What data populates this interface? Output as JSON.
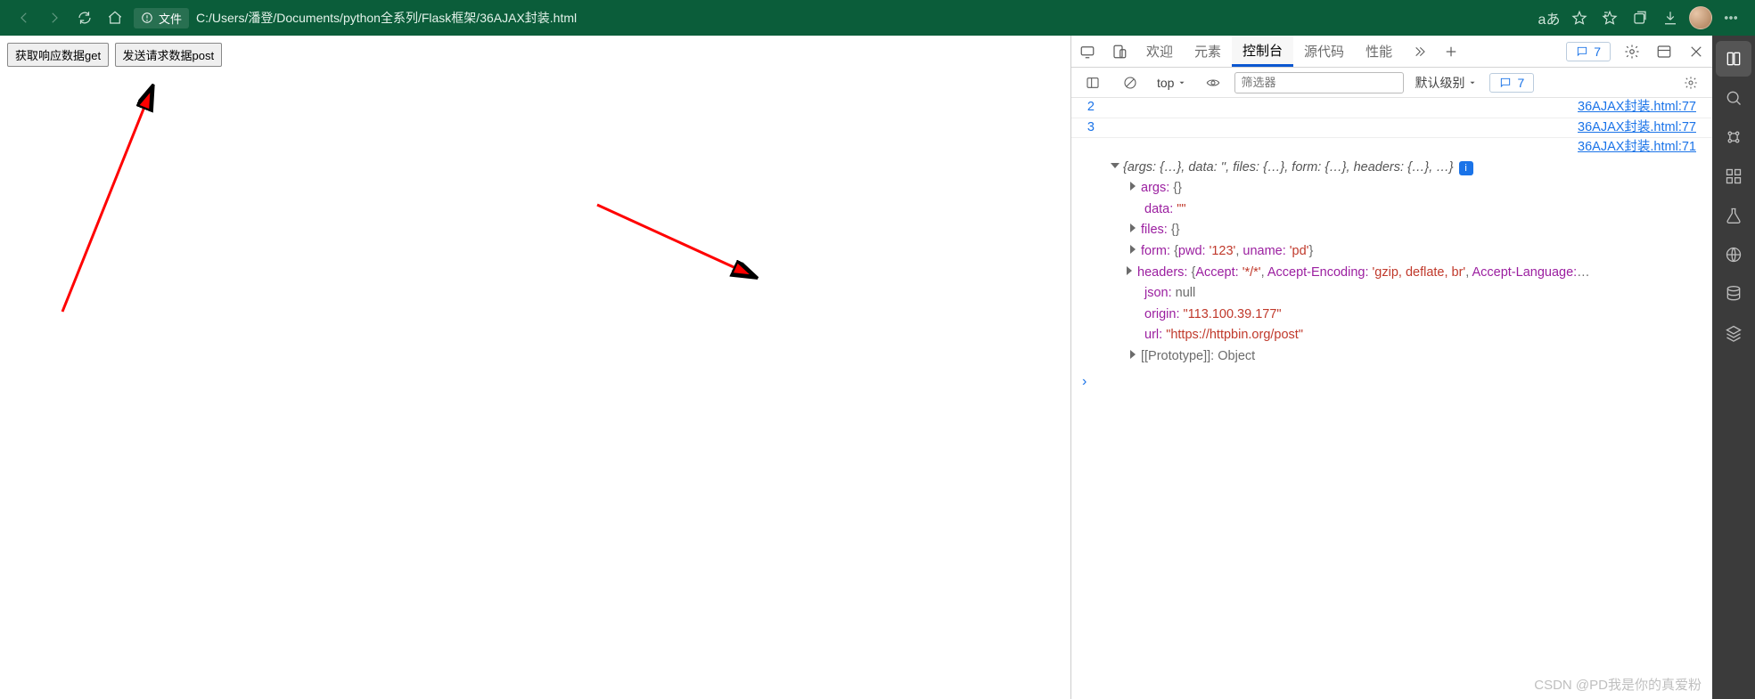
{
  "browser": {
    "badge_label": "文件",
    "url": "C:/Users/潘登/Documents/python全系列/Flask框架/36AJAX封装.html"
  },
  "page": {
    "btn_get": "获取响应数据get",
    "btn_post": "发送请求数据post"
  },
  "devtools": {
    "tabs": {
      "welcome": "欢迎",
      "elements": "元素",
      "console": "控制台",
      "sources": "源代码",
      "performance": "性能"
    },
    "issues_count": "7",
    "toolbar": {
      "context": "top",
      "filter_placeholder": "筛选器",
      "level": "默认级别",
      "issues": "7"
    },
    "rows": [
      {
        "gutter": "2",
        "link": "36AJAX封装.html:77"
      },
      {
        "gutter": "3",
        "link": "36AJAX封装.html:77"
      },
      {
        "gutter": "",
        "link": "36AJAX封装.html:71"
      }
    ],
    "obj_summary": "{args: {…}, data: '', files: {…}, form: {…}, headers: {…}, …}",
    "lines": {
      "args": {
        "k": "args:",
        "v": "{}"
      },
      "data": {
        "k": "data:",
        "v": "\"\""
      },
      "files": {
        "k": "files:",
        "v": "{}"
      },
      "form": {
        "k": "form:",
        "pwd_k": "pwd:",
        "pwd_v": "'123'",
        "uname_k": "uname:",
        "uname_v": "'pd'"
      },
      "headers": {
        "k": "headers:",
        "accept_k": "Accept:",
        "accept_v": "'*/*'",
        "enc_k": "Accept-Encoding:",
        "enc_v": "'gzip, deflate, br'",
        "lang_k": "Accept-Language:"
      },
      "json": {
        "k": "json:",
        "v": "null"
      },
      "origin": {
        "k": "origin:",
        "v": "\"113.100.39.177\""
      },
      "url": {
        "k": "url:",
        "v": "\"https://httpbin.org/post\""
      },
      "proto": {
        "k": "[[Prototype]]:",
        "v": "Object"
      }
    }
  },
  "watermark": "CSDN @PD我是你的真爱粉"
}
